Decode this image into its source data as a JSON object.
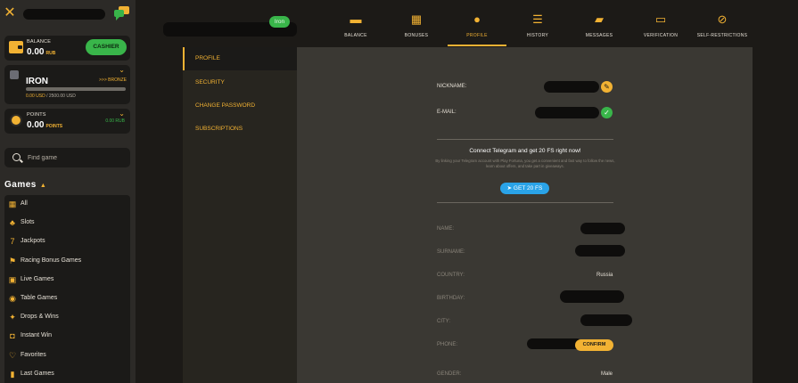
{
  "header": {
    "level_badge": "Iron"
  },
  "sidebar": {
    "balance": {
      "label": "BALANCE",
      "value": "0.00",
      "currency": "RUB",
      "cashier_label": "CASHIER"
    },
    "level": {
      "name": "IRON",
      "next_rank": "BRONZE",
      "progress_fraction": 0.0,
      "progress_current": "0.00 USD",
      "progress_total": "/ 2500.00 USD"
    },
    "points": {
      "label": "POINTS",
      "value": "0.00",
      "unit": "POINTS",
      "right_value": "0.00 RUB"
    },
    "search": {
      "placeholder": "Find game"
    },
    "games_heading": "Games",
    "games": [
      {
        "label": "All",
        "icon": "grid-icon"
      },
      {
        "label": "Slots",
        "icon": "cherry-icon"
      },
      {
        "label": "Jackpots",
        "icon": "seven-icon"
      },
      {
        "label": "Racing Bonus Games",
        "icon": "flag-icon"
      },
      {
        "label": "Live Games",
        "icon": "live-icon"
      },
      {
        "label": "Table Games",
        "icon": "chip-icon"
      },
      {
        "label": "Drops & Wins",
        "icon": "drops-icon"
      },
      {
        "label": "Instant Win",
        "icon": "gamepad-icon"
      },
      {
        "label": "Favorites",
        "icon": "heart-icon"
      },
      {
        "label": "Last Games",
        "icon": "bookmark-icon"
      }
    ]
  },
  "tabs": [
    {
      "label": "BALANCE",
      "icon": "wallet-icon",
      "active": false
    },
    {
      "label": "BONUSES",
      "icon": "gift-icon",
      "active": false
    },
    {
      "label": "PROFILE",
      "icon": "user-icon",
      "active": true
    },
    {
      "label": "HISTORY",
      "icon": "list-icon",
      "active": false
    },
    {
      "label": "MESSAGES",
      "icon": "chat-icon",
      "active": false
    },
    {
      "label": "VERIFICATION",
      "icon": "id-card-icon",
      "active": false
    },
    {
      "label": "SELF-RESTRICTIONS",
      "icon": "restriction-icon",
      "active": false
    }
  ],
  "profile_nav": [
    "PROFILE",
    "SECURITY",
    "CHANGE PASSWORD",
    "SUBSCRIPTIONS"
  ],
  "profile": {
    "nickname_label": "NICKNAME:",
    "email_label": "E-MAIL:",
    "telegram": {
      "title": "Connect Telegram and get 20 FS right now!",
      "description": "By linking your Telegram account with Play Fortuna, you get a convenient and fast way to follow the news, learn about offers, and take part in giveaways.",
      "button": "GET 20 FS"
    },
    "fields": {
      "name": "NAME:",
      "surname": "SURNAME:",
      "country": "COUNTRY:",
      "country_value": "Russia",
      "birthday": "BIRTHDAY:",
      "city": "CITY:",
      "phone": "PHONE:",
      "confirm": "CONFIRM",
      "gender": "GENDER:",
      "gender_value": "Male"
    }
  },
  "colors": {
    "accent": "#f2b233",
    "green": "#39b54a",
    "telegram": "#2aa3e8"
  }
}
